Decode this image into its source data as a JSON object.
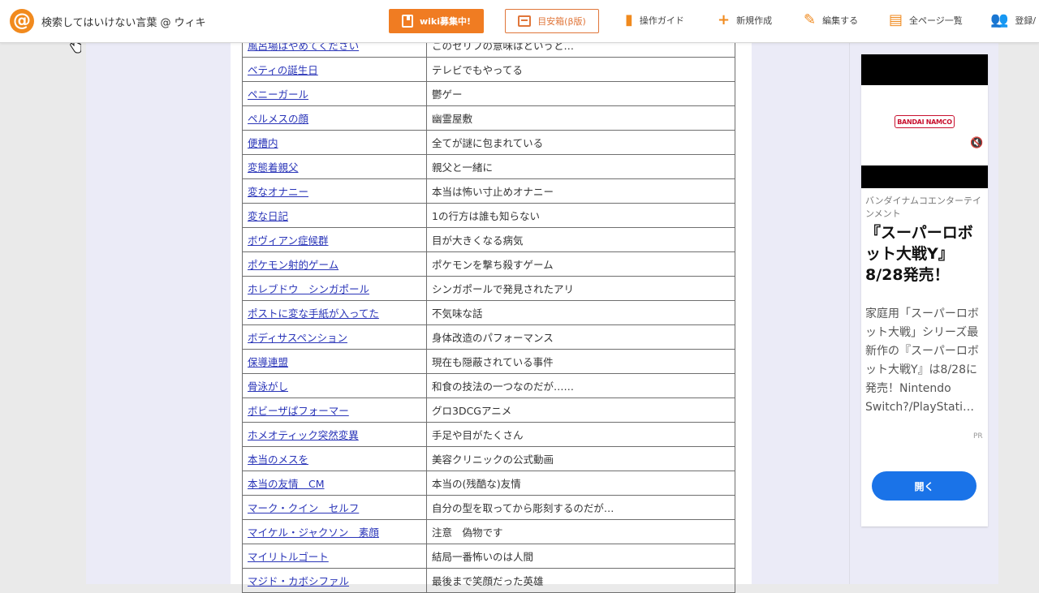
{
  "header": {
    "logo_glyph": "@",
    "site_title": "検索してはいけない言葉 @ ウィキ",
    "recruit_button": "wiki募集中!",
    "toc_button": "目安箱(β版)",
    "nav": [
      {
        "label": "操作ガイド",
        "icon": "guide-icon"
      },
      {
        "label": "新規作成",
        "icon": "plus-icon"
      },
      {
        "label": "編集する",
        "icon": "pencil-icon"
      },
      {
        "label": "全ページ一覧",
        "icon": "document-icon"
      },
      {
        "label": "登録/",
        "icon": "user-add-icon"
      }
    ],
    "accent_color": "#f07c22"
  },
  "table": {
    "rows": [
      {
        "term": "風呂場はやめてください",
        "desc": "このセリフの意味はというと…"
      },
      {
        "term": "ベティの誕生日",
        "desc": "テレビでもやってる"
      },
      {
        "term": "ペニーガール",
        "desc": "鬱ゲー"
      },
      {
        "term": "ペルメスの顔",
        "desc": "幽霊屋敷"
      },
      {
        "term": "便槽内",
        "desc": "全てが謎に包まれている"
      },
      {
        "term": "変態着親父",
        "desc": "親父と一緒に"
      },
      {
        "term": "変なオナニー",
        "desc": "本当は怖い寸止めオナニー"
      },
      {
        "term": "変な日記",
        "desc": "1の行方は誰も知らない"
      },
      {
        "term": "ボヴィアン症候群",
        "desc": "目が大きくなる病気"
      },
      {
        "term": "ポケモン射的ゲーム",
        "desc": "ポケモンを撃ち殺すゲーム"
      },
      {
        "term": "ホレブドウ　シンガポール",
        "desc": "シンガポールで発見されたアリ"
      },
      {
        "term": "ポストに変な手紙が入ってた",
        "desc": "不気味な話"
      },
      {
        "term": "ボディサスペンション",
        "desc": "身体改造のパフォーマンス"
      },
      {
        "term": "保導連盟",
        "desc": "現在も隠蔽されている事件"
      },
      {
        "term": "骨泳がし",
        "desc": "和食の技法の一つなのだが……"
      },
      {
        "term": "ボビーザぱフォーマー",
        "desc": "グロ3DCGアニメ"
      },
      {
        "term": "ホメオティック突然変異",
        "desc": "手足や目がたくさん"
      },
      {
        "term": "本当のメスを",
        "desc": "美容クリニックの公式動画"
      },
      {
        "term": "本当の友情　CM",
        "desc": "本当の(残酷な)友情"
      },
      {
        "term": "マーク・クイン　セルフ",
        "desc": "自分の型を取ってから彫刻するのだが…"
      },
      {
        "term": "マイケル・ジャクソン　素顔",
        "desc": "注意　偽物です"
      },
      {
        "term": "マイリトルゴート",
        "desc": "結局一番怖いのは人間"
      },
      {
        "term": "マジド・カボシファル",
        "desc": "最後まで笑顔だった英雄"
      }
    ]
  },
  "ad": {
    "brand": "BANDAI NAMCO",
    "advertiser": "バンダイナムコエンターテインメント",
    "headline": "『スーパーロボット大戦Y』8/28発売！",
    "body": "家庭用「スーパーロボット大戦」シリーズ最新作の『スーパーロボット大戦Y』は8/28に発売！Nintendo Switch?/PlayStati…",
    "pr": "PR",
    "open_button": "開く",
    "button_color": "#1a73e8"
  }
}
